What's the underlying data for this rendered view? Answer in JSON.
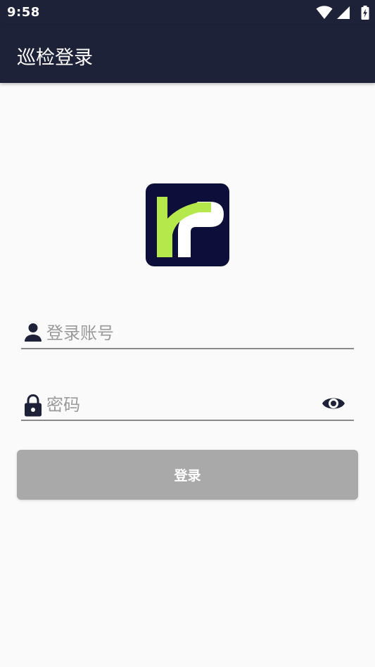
{
  "status_bar": {
    "time": "9:58",
    "icons": [
      "wifi-icon",
      "signal-icon",
      "battery-charging-icon"
    ]
  },
  "app_bar": {
    "title": "巡检登录"
  },
  "logo": {
    "icon": "app-logo",
    "colors": {
      "background": "#0d0f3a",
      "accent": "#b5e84a",
      "secondary": "#ffffff"
    }
  },
  "form": {
    "username": {
      "placeholder": "登录账号",
      "value": "",
      "icon": "person-icon"
    },
    "password": {
      "placeholder": "密码",
      "value": "",
      "icon": "lock-icon",
      "toggle_icon": "eye-icon"
    },
    "submit_label": "登录"
  },
  "colors": {
    "primary_dark": "#1e2238",
    "button_disabled": "#a9a9a9",
    "underline": "#8a8a8a",
    "background": "#fafafa"
  }
}
